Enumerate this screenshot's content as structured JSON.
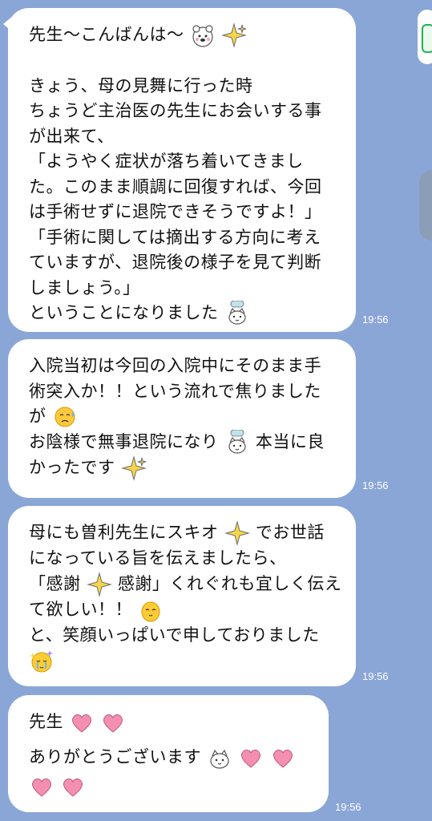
{
  "time_sent": "19:56",
  "messages": [
    {
      "lines": [
        "先生〜こんばんは〜",
        "",
        "きょう、母の見舞に行った時",
        "ちょうど主治医の先生にお会いする事",
        "が出来て、",
        "「ようやく症状が落ち着いてきまし",
        "た。このまま順調に回復すれば、今回",
        "は手術せずに退院できそうですよ！」",
        "「手術に関しては摘出する方向に考え",
        "ていますが、退院後の様子を見て判断",
        "しましょう。」",
        "ということになりました"
      ],
      "time": "19:56"
    },
    {
      "lines": [
        "入院当初は今回の入院中にそのまま手",
        "術突入か！！という流れで焦りました",
        "が",
        "お陰様で無事退院になり",
        "本当に良",
        "かったです"
      ],
      "time": "19:56"
    },
    {
      "lines": [
        "母にも曽利先生にスキオ",
        "でお世話",
        "になっている旨を伝えましたら、",
        "「感謝",
        "感謝」くれぐれも宜しく伝え",
        "て欲しい！！",
        "と、笑顔いっぱいで申しておりました"
      ],
      "time": "19:56"
    },
    {
      "lines": [
        "先生",
        "ありがとうございます"
      ],
      "time": "19:56"
    }
  ],
  "icons": [
    "bear-sticker-icon",
    "sparkle-icon",
    "bowing-cat-icon",
    "sweat-face-icon",
    "pleading-bird-icon",
    "crying-chick-icon",
    "heart-icon",
    "cat-face-icon"
  ],
  "colors": {
    "background": "#8aa6d6",
    "bubble": "#ffffff",
    "text": "#111111",
    "time": "#ffffff",
    "accent_green": "#23b24c",
    "sparkle": "#f5d54a",
    "heart": "#f48fb1"
  }
}
